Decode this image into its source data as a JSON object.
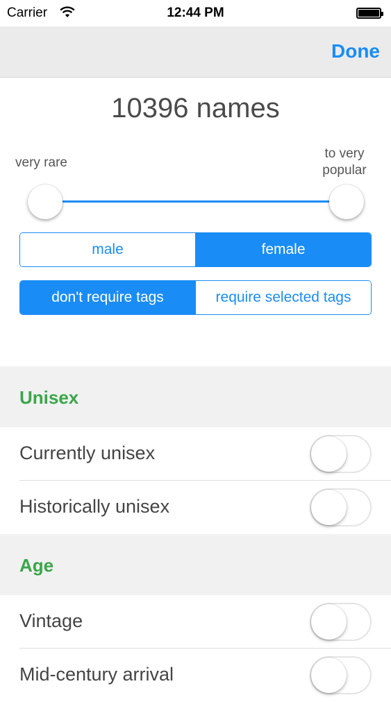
{
  "status_bar": {
    "carrier": "Carrier",
    "time": "12:44 PM",
    "icons": [
      "wifi-icon",
      "battery-icon"
    ]
  },
  "nav": {
    "done_label": "Done"
  },
  "summary": {
    "count_text": "10396 names"
  },
  "popularity": {
    "min_label": "very rare",
    "max_label_line1": "to very",
    "max_label_line2": "popular",
    "range_low": 0,
    "range_high": 1
  },
  "gender": {
    "options": [
      "male",
      "female"
    ],
    "selected": "female"
  },
  "tags_mode": {
    "options": [
      "don't require tags",
      "require selected tags"
    ],
    "selected": "don't require tags"
  },
  "sections": [
    {
      "title": "Unisex",
      "items": [
        {
          "label": "Currently unisex",
          "on": false
        },
        {
          "label": "Historically unisex",
          "on": false
        }
      ]
    },
    {
      "title": "Age",
      "items": [
        {
          "label": "Vintage",
          "on": false
        },
        {
          "label": "Mid-century arrival",
          "on": false
        }
      ]
    }
  ],
  "colors": {
    "accent": "#1a8cf5",
    "section_title": "#3aa64a",
    "nav_background": "#ebebeb",
    "section_background": "#f1f1f1"
  }
}
